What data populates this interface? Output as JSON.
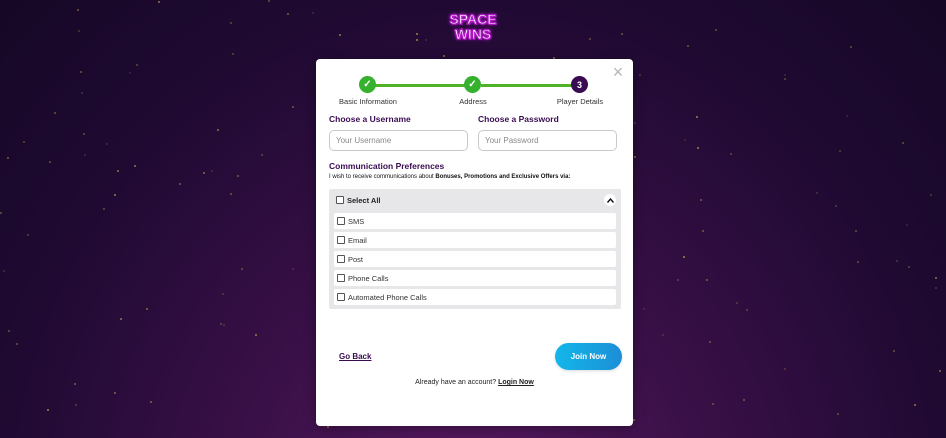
{
  "logo": {
    "line1": "SPACE",
    "line2": "WINS"
  },
  "modal": {
    "close_icon": "×",
    "steps": [
      {
        "label": "Basic Information",
        "status": "done",
        "icon": "✓"
      },
      {
        "label": "Address",
        "status": "done",
        "icon": "✓"
      },
      {
        "label": "Player Details",
        "status": "current",
        "number": "3"
      }
    ],
    "username": {
      "label": "Choose a Username",
      "placeholder": "Your Username"
    },
    "password": {
      "label": "Choose a Password",
      "placeholder": "Your Password"
    },
    "preferences": {
      "title": "Communication Preferences",
      "intro_prefix": "I wish to receive communications about ",
      "intro_bold": "Bonuses, Promotions and Exclusive Offers via:",
      "select_all": "Select All",
      "collapse_icon": "chevron-up-icon",
      "options": [
        "SMS",
        "Email",
        "Post",
        "Phone Calls",
        "Automated Phone Calls"
      ]
    },
    "go_back": "Go Back",
    "join_now": "Join Now",
    "already_text": "Already have an account?",
    "login_now": "Login Now"
  },
  "colors": {
    "step_done": "#36b12e",
    "step_current": "#3a0b52",
    "primary_button": "#13b7ea",
    "heading": "#3a0b52"
  }
}
